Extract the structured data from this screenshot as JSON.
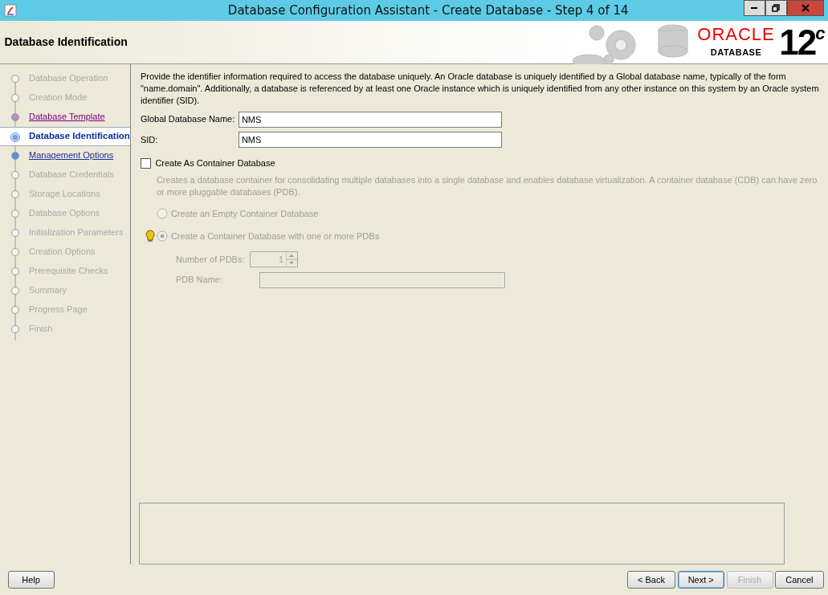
{
  "window": {
    "title": "Database Configuration Assistant - Create Database - Step 4 of 14"
  },
  "header": {
    "title": "Database Identification",
    "logo": {
      "brand": "ORACLE",
      "product": "DATABASE",
      "version": "12",
      "version_suffix": "c"
    }
  },
  "steps": [
    {
      "label": "Database Operation",
      "disabled": true,
      "visited": false,
      "selected": false
    },
    {
      "label": "Creation Mode",
      "disabled": true,
      "visited": false,
      "selected": false
    },
    {
      "label": "Database Template",
      "disabled": false,
      "visited": true,
      "selected": false
    },
    {
      "label": "Database Identification",
      "disabled": false,
      "visited": false,
      "selected": true
    },
    {
      "label": "Management Options",
      "disabled": false,
      "visited": false,
      "selected": false
    },
    {
      "label": "Database Credentials",
      "disabled": true,
      "visited": false,
      "selected": false
    },
    {
      "label": "Storage Locations",
      "disabled": true,
      "visited": false,
      "selected": false
    },
    {
      "label": "Database Options",
      "disabled": true,
      "visited": false,
      "selected": false
    },
    {
      "label": "Initialization Parameters",
      "disabled": true,
      "visited": false,
      "selected": false
    },
    {
      "label": "Creation Options",
      "disabled": true,
      "visited": false,
      "selected": false
    },
    {
      "label": "Prerequisite Checks",
      "disabled": true,
      "visited": false,
      "selected": false
    },
    {
      "label": "Summary",
      "disabled": true,
      "visited": false,
      "selected": false
    },
    {
      "label": "Progress Page",
      "disabled": true,
      "visited": false,
      "selected": false
    },
    {
      "label": "Finish",
      "disabled": true,
      "visited": false,
      "selected": false
    }
  ],
  "intro": "Provide the identifier information required to access the database uniquely. An Oracle database is uniquely identified by a Global database name, typically of the form \"name.domain\". Additionally, a database is referenced by at least one Oracle instance which is uniquely identified from any other instance on this system by an Oracle system identifier (SID).",
  "fields": [
    {
      "label": "Global Database Name:",
      "value": "NMS"
    },
    {
      "label": "SID:",
      "value": "NMS"
    }
  ],
  "container": {
    "label": "Create As Container Database",
    "checked": false,
    "description": "Creates a database container for consolidating multiple databases into a single database and enables database virtualization. A container database (CDB) can have zero or more pluggable databases (PDB).",
    "options": [
      {
        "label": "Create an Empty Container Database",
        "selected": false,
        "disabled": true,
        "hint": false
      },
      {
        "label": "Create a Container Database with one or more PDBs",
        "selected": true,
        "disabled": true,
        "hint": true
      }
    ],
    "pdb_count": {
      "label": "Number of PDBs:",
      "value": "1",
      "disabled": true
    },
    "pdb_name": {
      "label": "PDB Name:",
      "disabled": true
    }
  },
  "help_button": {
    "label": "Help"
  },
  "buttons": [
    {
      "label": "< Back",
      "disabled": false,
      "default": false
    },
    {
      "label": "Next >",
      "disabled": false,
      "default": true
    },
    {
      "label": "Finish",
      "disabled": true,
      "default": false
    },
    {
      "label": "Cancel",
      "disabled": false,
      "default": false
    }
  ]
}
